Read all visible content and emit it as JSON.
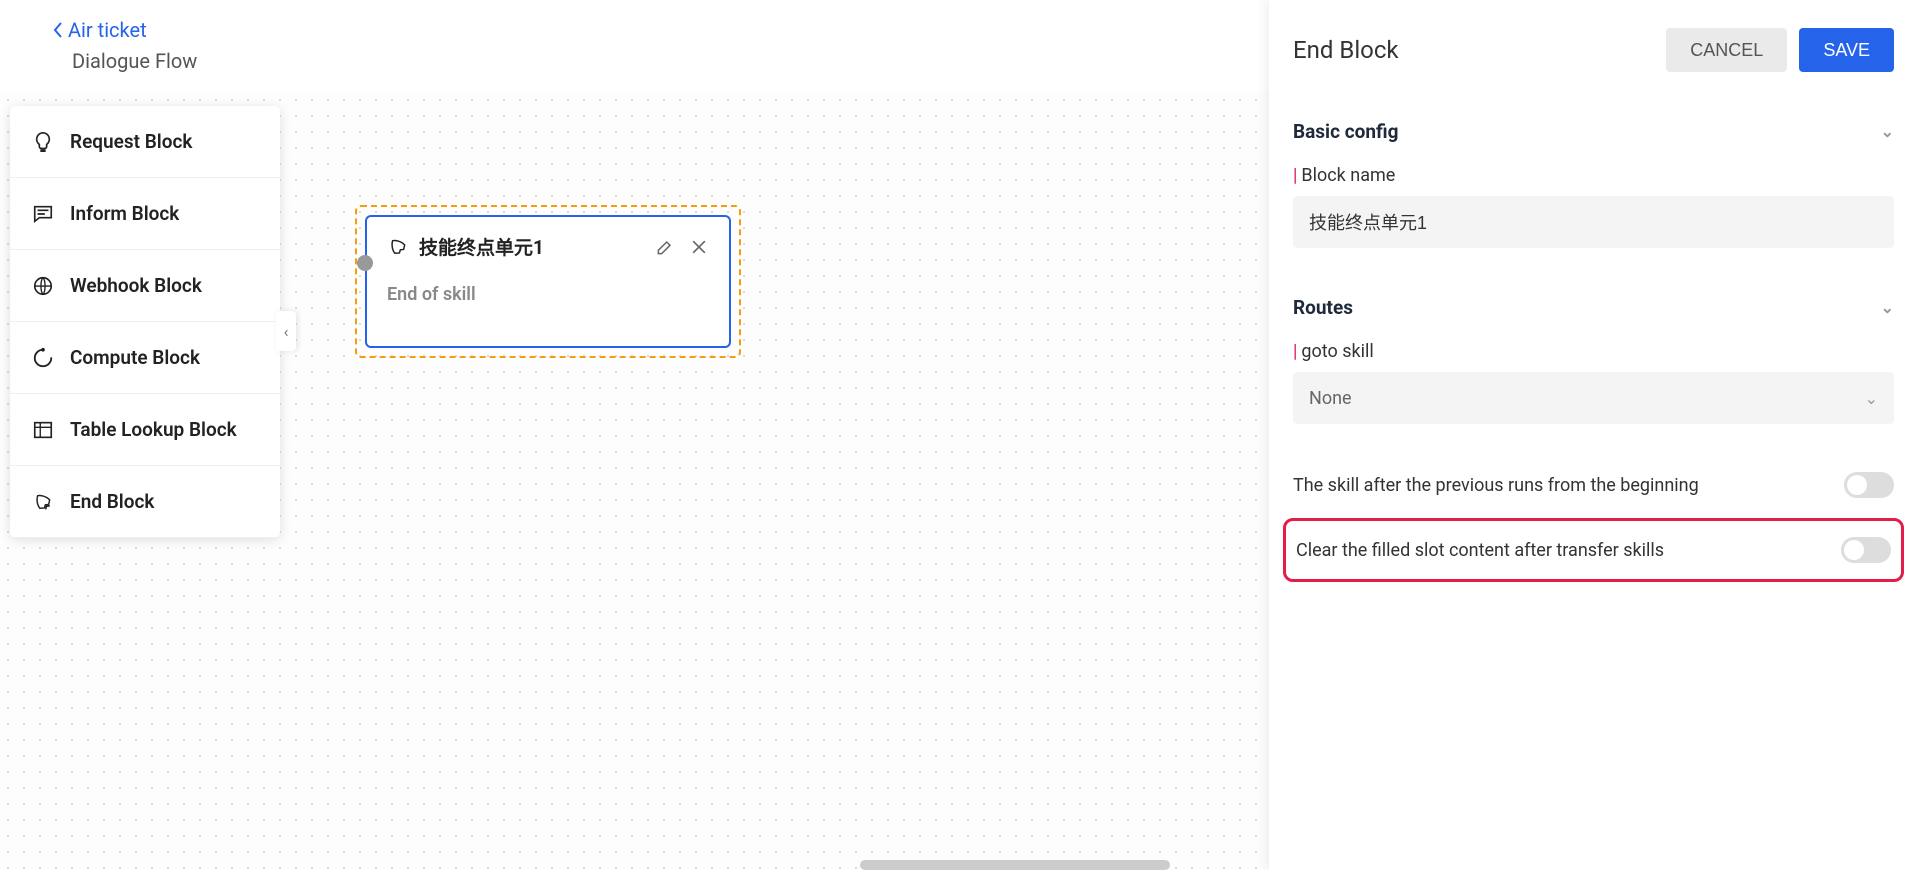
{
  "header": {
    "back_label": "Air ticket",
    "page_title": "Dialogue Flow"
  },
  "palette": {
    "items": [
      {
        "label": "Request Block",
        "icon": "bulb"
      },
      {
        "label": "Inform Block",
        "icon": "chat"
      },
      {
        "label": "Webhook Block",
        "icon": "globe"
      },
      {
        "label": "Compute Block",
        "icon": "spinner"
      },
      {
        "label": "Table Lookup Block",
        "icon": "table"
      },
      {
        "label": "End Block",
        "icon": "rocket"
      }
    ]
  },
  "node": {
    "title": "技能终点单元1",
    "body": "End of skill"
  },
  "panel": {
    "title": "End Block",
    "cancel": "CANCEL",
    "save": "SAVE",
    "basic_config_title": "Basic config",
    "block_name_label": "Block name",
    "block_name_value": "技能终点单元1",
    "routes_title": "Routes",
    "goto_label": "goto skill",
    "goto_value": "None",
    "toggle1_label": "The skill after the previous runs from the beginning",
    "toggle2_label": "Clear the filled slot content after transfer skills"
  }
}
